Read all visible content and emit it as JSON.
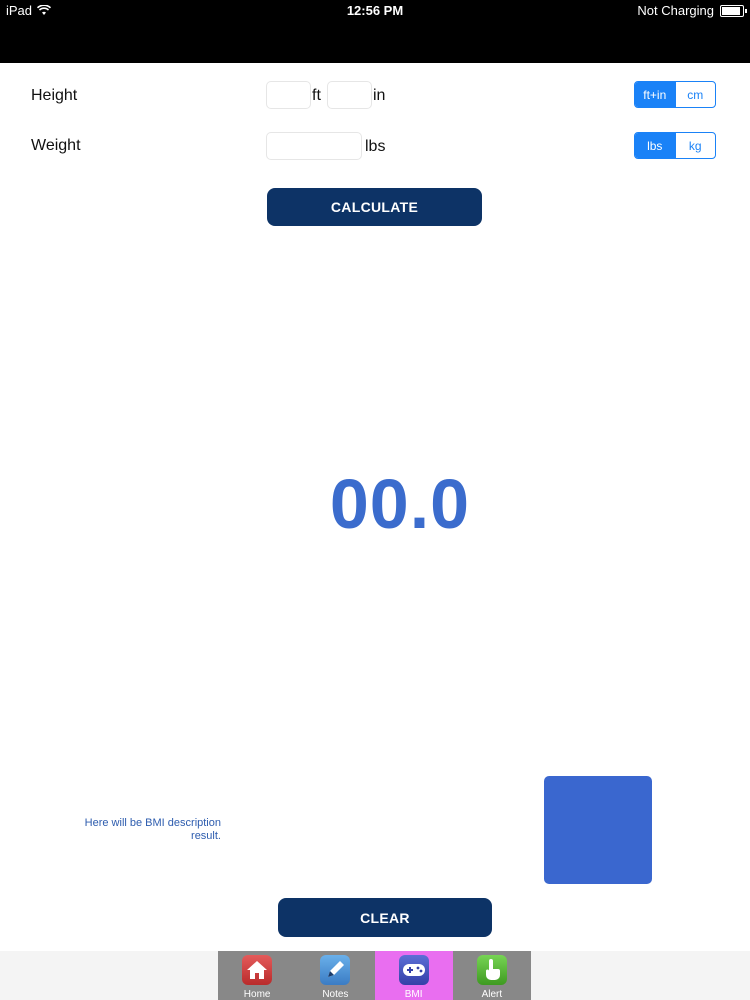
{
  "status_bar": {
    "device": "iPad",
    "time": "12:56 PM",
    "charging": "Not Charging"
  },
  "form": {
    "height_label": "Height",
    "height_ft_unit": "ft",
    "height_in_unit": "in",
    "height_ft_value": "",
    "height_in_value": "",
    "height_units": [
      {
        "label": "ft+in",
        "selected": true
      },
      {
        "label": "cm",
        "selected": false
      }
    ],
    "weight_label": "Weight",
    "weight_value": "",
    "weight_unit": "lbs",
    "weight_units": [
      {
        "label": "lbs",
        "selected": true
      },
      {
        "label": "kg",
        "selected": false
      }
    ]
  },
  "calculate_label": "CALCULATE",
  "result": {
    "bmi_value": "00.0",
    "description": "Here will be BMI description result.",
    "category_color": "#3a67cf"
  },
  "clear_label": "CLEAR",
  "tab_bar": {
    "tabs": [
      {
        "label": "Home",
        "icon": "home-icon",
        "selected": false
      },
      {
        "label": "Notes",
        "icon": "notes-icon",
        "selected": false
      },
      {
        "label": "BMI",
        "icon": "gamepad-icon",
        "selected": true
      },
      {
        "label": "Alert",
        "icon": "hand-pointer-icon",
        "selected": false
      }
    ]
  }
}
